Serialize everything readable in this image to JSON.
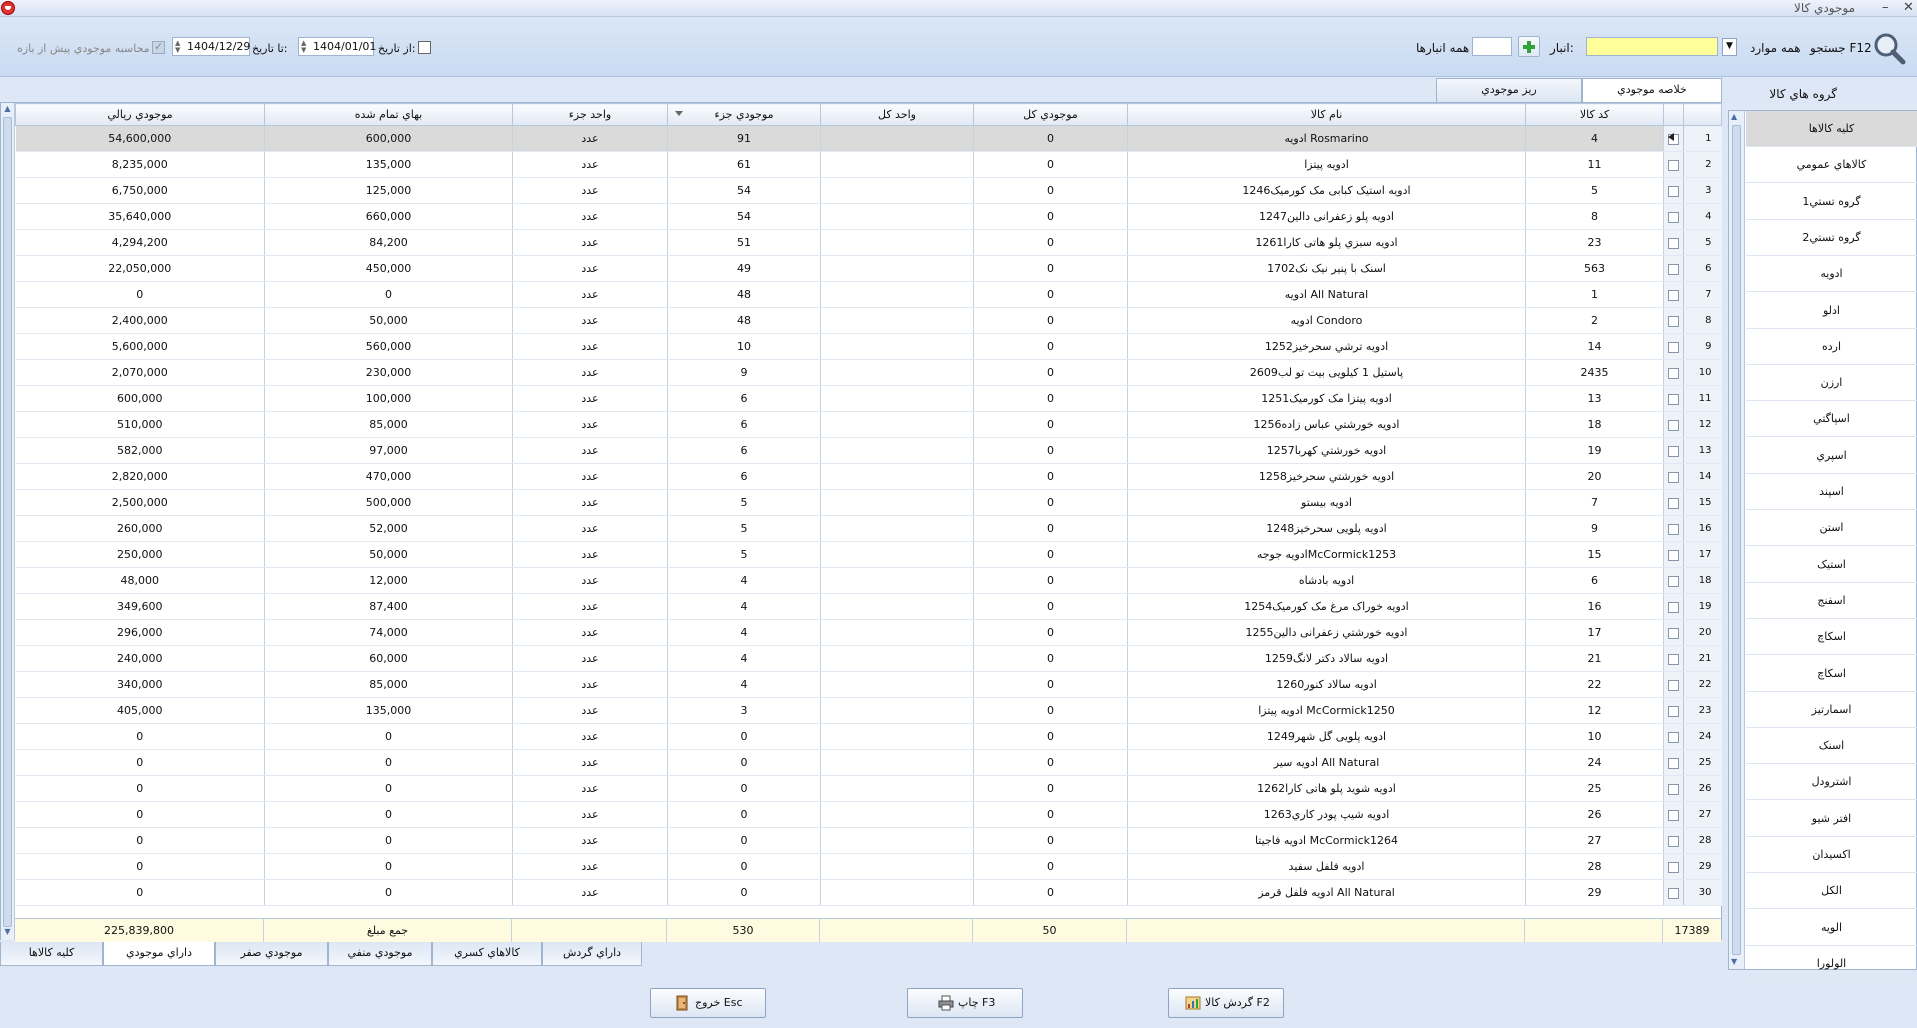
{
  "window": {
    "title": "موجودي کالا",
    "minimize": "–",
    "close": "✕"
  },
  "toolbar": {
    "search_label": "جستجو F12",
    "all_items_label": "همه موارد",
    "warehouse_label": "انبار:",
    "all_warehouses_label": "همه انبارها",
    "from_date_label": "از تاریخ:",
    "from_date_value": "1404/01/01",
    "to_date_label": "تا تاریخ:",
    "to_date_value": "1404/12/29",
    "calc_label": "محاسبه موجودي پیش از بازه"
  },
  "top_tabs": [
    {
      "label": "خلاصه موجودي",
      "active": true
    },
    {
      "label": "ریز موجودي",
      "active": false
    }
  ],
  "columns": [
    "کد کالا",
    "نام کالا",
    "موجودي کل",
    "واحد کل",
    "موجودي جزء",
    "واحد جزء",
    "بهاي تمام شده",
    "موجودي ريالي"
  ],
  "rows": [
    [
      "1",
      "4",
      "ادویه Rosmarino",
      "0",
      "",
      "91",
      "عدد",
      "600,000",
      "54,600,000"
    ],
    [
      "2",
      "11",
      "ادویه پیتزا",
      "0",
      "",
      "61",
      "عدد",
      "135,000",
      "8,235,000"
    ],
    [
      "3",
      "5",
      "ادویه استیک کبابی مک کورمیک1246",
      "0",
      "",
      "54",
      "عدد",
      "125,000",
      "6,750,000"
    ],
    [
      "4",
      "8",
      "ادویه پلو زعفرانی دالین1247",
      "0",
      "",
      "54",
      "عدد",
      "660,000",
      "35,640,000"
    ],
    [
      "5",
      "23",
      "ادویه سبزي پلو هاتی کارا1261",
      "0",
      "",
      "51",
      "عدد",
      "84,200",
      "4,294,200"
    ],
    [
      "6",
      "563",
      "اسنک با پنیر نیک نک1702",
      "0",
      "",
      "49",
      "عدد",
      "450,000",
      "22,050,000"
    ],
    [
      "7",
      "1",
      "ادویه All Natural",
      "0",
      "",
      "48",
      "عدد",
      "0",
      "0"
    ],
    [
      "8",
      "2",
      "ادویه Condoro",
      "0",
      "",
      "48",
      "عدد",
      "50,000",
      "2,400,000"
    ],
    [
      "9",
      "14",
      "ادویه ترشي سحرخیز1252",
      "0",
      "",
      "10",
      "عدد",
      "560,000",
      "5,600,000"
    ],
    [
      "10",
      "2435",
      "پاستیل 1 کیلویی بیت تو لب2609",
      "0",
      "",
      "9",
      "عدد",
      "230,000",
      "2,070,000"
    ],
    [
      "11",
      "13",
      "ادویه پیتزا مک کورمیک1251",
      "0",
      "",
      "6",
      "عدد",
      "100,000",
      "600,000"
    ],
    [
      "12",
      "18",
      "ادویه خورشتي عباس زاده1256",
      "0",
      "",
      "6",
      "عدد",
      "85,000",
      "510,000"
    ],
    [
      "13",
      "19",
      "ادویه خورشتي کهربا1257",
      "0",
      "",
      "6",
      "عدد",
      "97,000",
      "582,000"
    ],
    [
      "14",
      "20",
      "ادویه خورشتي سحرخیز1258",
      "0",
      "",
      "6",
      "عدد",
      "470,000",
      "2,820,000"
    ],
    [
      "15",
      "7",
      "ادویه بیستو",
      "0",
      "",
      "5",
      "عدد",
      "500,000",
      "2,500,000"
    ],
    [
      "16",
      "9",
      "ادویه پلویی سحرخیز1248",
      "0",
      "",
      "5",
      "عدد",
      "52,000",
      "260,000"
    ],
    [
      "17",
      "15",
      "ادویه جوجهMcCormick1253",
      "0",
      "",
      "5",
      "عدد",
      "50,000",
      "250,000"
    ],
    [
      "18",
      "6",
      "ادویه بادشاه",
      "0",
      "",
      "4",
      "عدد",
      "12,000",
      "48,000"
    ],
    [
      "19",
      "16",
      "ادویه خوراک مرغ مک کورمیک1254",
      "0",
      "",
      "4",
      "عدد",
      "87,400",
      "349,600"
    ],
    [
      "20",
      "17",
      "ادویه خورشتي زعفرانی دالین1255",
      "0",
      "",
      "4",
      "عدد",
      "74,000",
      "296,000"
    ],
    [
      "21",
      "21",
      "ادویه سالاد دکتر لانگ1259",
      "0",
      "",
      "4",
      "عدد",
      "60,000",
      "240,000"
    ],
    [
      "22",
      "22",
      "ادویه سالاد کنور1260",
      "0",
      "",
      "4",
      "عدد",
      "85,000",
      "340,000"
    ],
    [
      "23",
      "12",
      "ادویه پیتزا McCormick1250",
      "0",
      "",
      "3",
      "عدد",
      "135,000",
      "405,000"
    ],
    [
      "24",
      "10",
      "ادویه پلویی گل شهر1249",
      "0",
      "",
      "0",
      "عدد",
      "0",
      "0"
    ],
    [
      "25",
      "24",
      "ادویه سیر All Natural",
      "0",
      "",
      "0",
      "عدد",
      "0",
      "0"
    ],
    [
      "26",
      "25",
      "ادویه شوید پلو هاتی کارا1262",
      "0",
      "",
      "0",
      "عدد",
      "0",
      "0"
    ],
    [
      "27",
      "26",
      "ادویه شیپ پودر کاري1263",
      "0",
      "",
      "0",
      "عدد",
      "0",
      "0"
    ],
    [
      "28",
      "27",
      "ادویه فاجیتا McCormick1264",
      "0",
      "",
      "0",
      "عدد",
      "0",
      "0"
    ],
    [
      "29",
      "28",
      "ادویه فلفل سفید",
      "0",
      "",
      "0",
      "عدد",
      "0",
      "0"
    ],
    [
      "30",
      "29",
      "ادویه فلفل قرمز All Natural",
      "0",
      "",
      "0",
      "عدد",
      "0",
      "0"
    ]
  ],
  "footer": {
    "row_count": "17389",
    "total_qty": "50",
    "part_qty": "530",
    "sum_label": "جمع مبلغ",
    "total_value": "225,839,800"
  },
  "bottom_tabs": [
    {
      "label": "کلیه کالاها",
      "active": false
    },
    {
      "label": "داراي موجودي",
      "active": true
    },
    {
      "label": "موجودي صفر",
      "active": false
    },
    {
      "label": "موجودي منفي",
      "active": false
    },
    {
      "label": "کالاهاي کسري",
      "active": false
    },
    {
      "label": "داراي گردش",
      "active": false
    }
  ],
  "sidebar": {
    "header": "گروه هاي کالا",
    "items": [
      "کلیه کالاها",
      "کالاهاي عمومي",
      "گروه تستي1",
      "گروه تستي2",
      "ادویه",
      "ادلو",
      "ارده",
      "ارزن",
      "اسپاگتي",
      "اسپري",
      "اسپند",
      "استن",
      "استیک",
      "اسفنج",
      "اسکاچ",
      "اسکاچ",
      "اسمارتیز",
      "اسنک",
      "اشترودل",
      "افتر شیو",
      "اکسیدان",
      "الکل",
      "الویه",
      "الولورا"
    ]
  },
  "buttons": {
    "exit": "خروج Esc",
    "print": "چاپ F3",
    "turnover": "گردش کالا F2"
  }
}
